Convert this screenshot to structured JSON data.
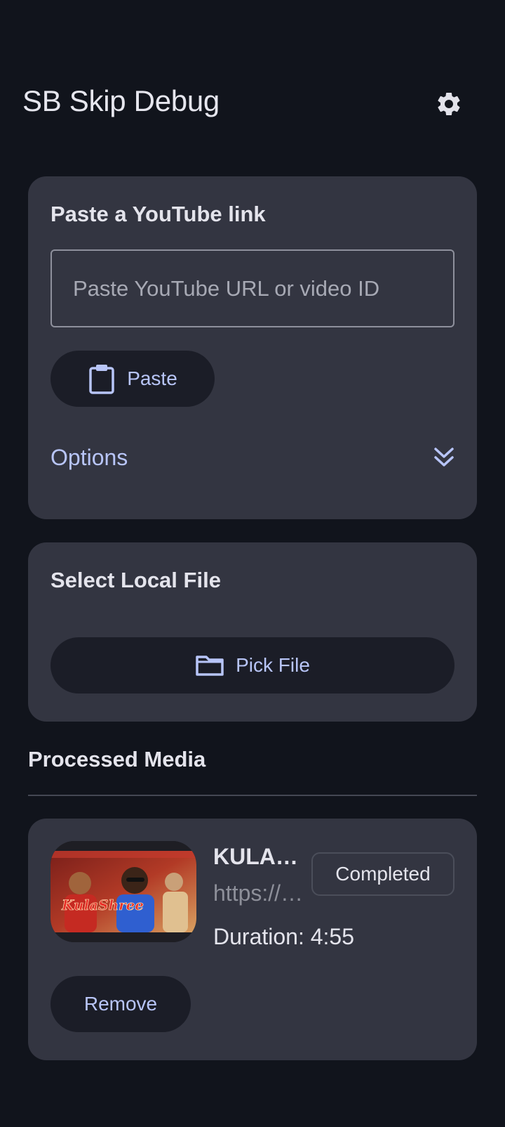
{
  "app_bar": {
    "title": "SB Skip Debug",
    "settings_icon": "gear-icon"
  },
  "youtube_card": {
    "heading": "Paste a YouTube link",
    "input_value": "",
    "input_placeholder": "Paste YouTube URL or video ID",
    "paste_label": "Paste",
    "paste_icon": "clipboard-icon",
    "options_label": "Options",
    "options_icon": "double-chevron-down-icon"
  },
  "local_card": {
    "heading": "Select Local File",
    "pick_label": "Pick File",
    "pick_icon": "folder-icon"
  },
  "processed": {
    "section_title": "Processed Media",
    "items": [
      {
        "title": "KULASHREE",
        "url": "https://www.youtube.com/watch",
        "status": "Completed",
        "duration": "Duration: 4:55",
        "thumbnail_text": "KulaShree",
        "remove_label": "Remove"
      }
    ]
  },
  "colors": {
    "background": "#11141c",
    "card": "#333541",
    "button": "#1b1d27",
    "accent": "#b8c5f8",
    "text": "#e4e4ec",
    "thumbnail_title": "#e8302a"
  }
}
